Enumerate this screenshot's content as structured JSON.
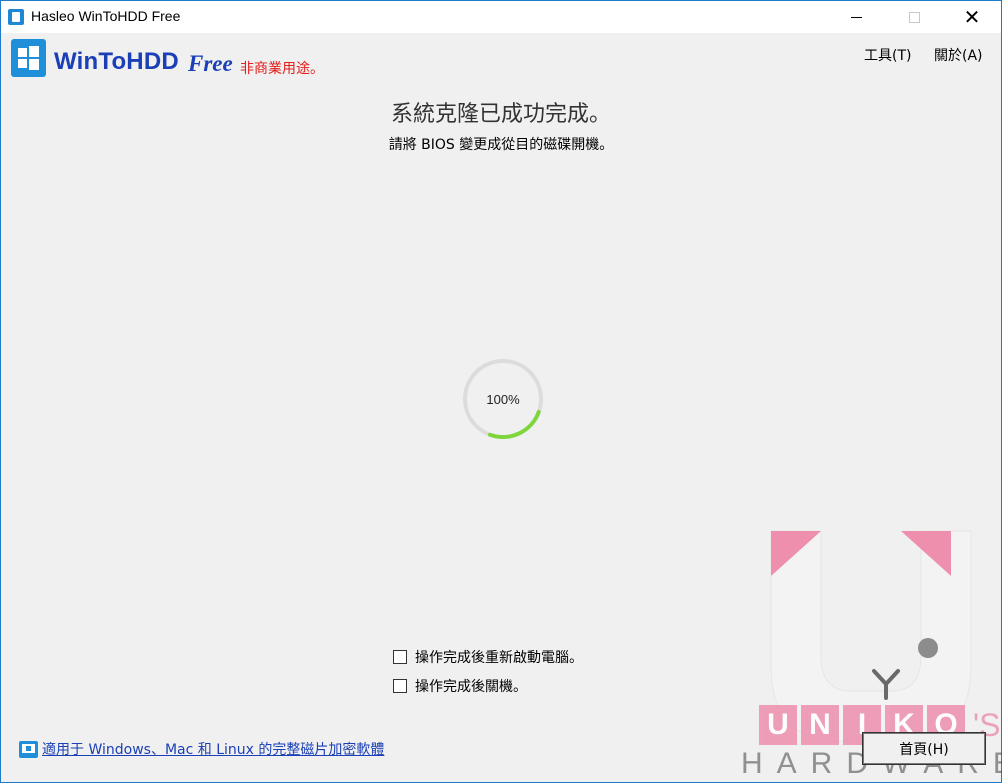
{
  "window": {
    "title": "Hasleo WinToHDD Free"
  },
  "logo": {
    "name": "WinToHDD",
    "edition": "Free",
    "note": "非商業用途。"
  },
  "menu": {
    "tools": "工具(T)",
    "about": "關於(A)"
  },
  "status": {
    "headline": "系統克隆已成功完成。",
    "subline": "請將 BIOS 變更成從目的磁碟開機。"
  },
  "progress": {
    "percent": 100,
    "label": "100%"
  },
  "options": [
    {
      "label": "操作完成後重新啟動電腦。",
      "checked": false
    },
    {
      "label": "操作完成後關機。",
      "checked": false
    }
  ],
  "promo": {
    "text": "適用于 Windows、Mac 和 Linux 的完整磁片加密軟體"
  },
  "buttons": {
    "home": "首頁(H)"
  },
  "watermark": {
    "letters": [
      "U",
      "N",
      "I",
      "K",
      "O"
    ],
    "suffix": "'S",
    "line2": "HARDWARE"
  },
  "colors": {
    "brand_blue": "#1a3fb6",
    "accent_red": "#e0201c",
    "progress_green": "#7ed63a",
    "watermark_pink": "#ee8fae"
  }
}
